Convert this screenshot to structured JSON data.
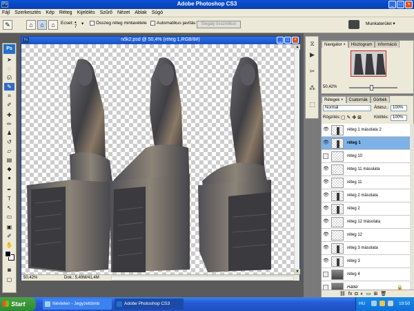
{
  "app": {
    "title": "Adobe Photoshop CS3",
    "logo": "Ps"
  },
  "menu": [
    "Fájl",
    "Szerkesztés",
    "Kép",
    "Réteg",
    "Kijelölés",
    "Szűrő",
    "Nézet",
    "Ablak",
    "Súgó"
  ],
  "options": {
    "brush_label": "Ecset:",
    "brush_size": "7",
    "sample_all_label": "Összeg réteg mintavétele",
    "auto_label": "Automatikus javítás",
    "sample_button": "Stegaly összmiikus",
    "workspace_label": "Munkaterület ▾"
  },
  "document": {
    "title": "nők2.psd @ 50,4% (réteg 1,RGB/8#)",
    "zoom": "50,42%",
    "doc_info": "Dok.: 5,49M/41,4M"
  },
  "navigator": {
    "tabs": [
      "Navigátor ×",
      "Hisztogram",
      "Információ"
    ],
    "zoom": "50,42%"
  },
  "layers": {
    "tabs": [
      "Rétegek ×",
      "Csatornák",
      "Görbék"
    ],
    "blend_mode": "Normál",
    "opacity_label": "Átlátsz.:",
    "opacity": "100%",
    "lock_label": "Rögzítés:",
    "fill_label": "Kitöltés:",
    "fill": "100%",
    "items": [
      {
        "name": "réteg 1 másolata 2",
        "visible": true,
        "thumb": "figure",
        "selected": false
      },
      {
        "name": "réteg 1",
        "visible": true,
        "thumb": "figure",
        "selected": true
      },
      {
        "name": "réteg 10",
        "visible": false,
        "thumb": "empty",
        "selected": false
      },
      {
        "name": "réteg 11 másolata",
        "visible": true,
        "thumb": "empty",
        "selected": false
      },
      {
        "name": "réteg 11",
        "visible": true,
        "thumb": "empty",
        "selected": false
      },
      {
        "name": "réteg 2 másolata",
        "visible": true,
        "thumb": "figure",
        "selected": false
      },
      {
        "name": "réteg 2",
        "visible": true,
        "thumb": "figure",
        "selected": false
      },
      {
        "name": "réteg 12 másolata",
        "visible": true,
        "thumb": "empty",
        "selected": false
      },
      {
        "name": "réteg 12",
        "visible": true,
        "thumb": "empty",
        "selected": false
      },
      {
        "name": "réteg 3 másolata",
        "visible": true,
        "thumb": "figure",
        "selected": false
      },
      {
        "name": "réteg 3",
        "visible": true,
        "thumb": "figure",
        "selected": false
      },
      {
        "name": "réteg 4",
        "visible": false,
        "thumb": "full",
        "selected": false
      },
      {
        "name": "Háttér",
        "visible": false,
        "thumb": "full",
        "selected": false
      }
    ]
  },
  "taskbar": {
    "start": "Start",
    "tasks": [
      "Névtelen - Jegyzettömb",
      "Adobe Photoshop CS3"
    ],
    "lang": "HU",
    "clock": "19:50"
  },
  "colors": {
    "title_blue": "#0b52d6",
    "selection": "#316ac5",
    "taskbar": "#245bd4"
  }
}
